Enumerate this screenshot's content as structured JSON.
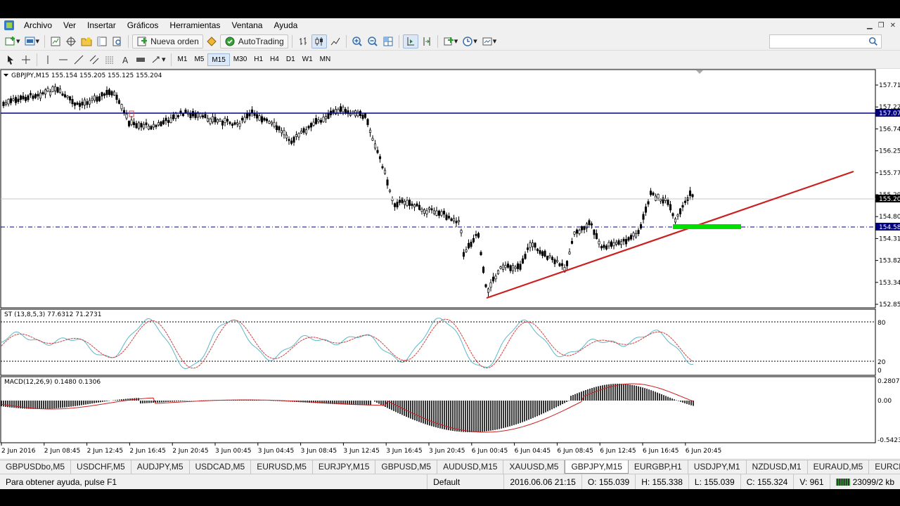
{
  "menubar": {
    "items": [
      "Archivo",
      "Ver",
      "Insertar",
      "Gráficos",
      "Herramientas",
      "Ventana",
      "Ayuda"
    ]
  },
  "toolbar": {
    "new_order_label": "Nueva orden",
    "autotrading_label": "AutoTrading",
    "timeframes": [
      "M1",
      "M5",
      "M15",
      "M30",
      "H1",
      "H4",
      "D1",
      "W1",
      "MN"
    ],
    "active_timeframe": "M15"
  },
  "chart": {
    "header": "GBPJPY,M15  155.154 155.205 155.125 155.204",
    "price_labels": [
      "157.710",
      "157.220",
      "156.740",
      "156.250",
      "155.770",
      "155.290",
      "154.800",
      "154.310",
      "153.820",
      "153.340",
      "152.850"
    ],
    "hline_blue_label": "157.077",
    "hline_dash_label": "154.580",
    "current_price_label": "155.204",
    "time_labels": [
      "2 Jun 2016",
      "2 Jun 08:45",
      "2 Jun 12:45",
      "2 Jun 16:45",
      "2 Jun 20:45",
      "3 Jun 00:45",
      "3 Jun 04:45",
      "3 Jun 08:45",
      "3 Jun 12:45",
      "3 Jun 16:45",
      "3 Jun 20:45",
      "6 Jun 00:45",
      "6 Jun 04:45",
      "6 Jun 08:45",
      "6 Jun 12:45",
      "6 Jun 16:45",
      "6 Jun 20:45"
    ],
    "colors": {
      "candle": "#000000",
      "hline_blue": "#000080",
      "trendline": "#cc2020",
      "marker_green": "#00e000",
      "stoch_main": "#5bb8c8",
      "stoch_signal": "#d04040",
      "macd_signal": "#cc2020"
    }
  },
  "stochastic": {
    "header": "ST (13,8,5,3) 77.6312 71.2731",
    "levels": [
      "80",
      "20",
      "0"
    ]
  },
  "macd": {
    "header": "MACD(12,26,9) 0.1480 0.1306",
    "labels": [
      "0.2807",
      "0.00",
      "-0.5423"
    ]
  },
  "tabs": [
    "GBPUSDbo,M5",
    "USDCHF,M5",
    "AUDJPY,M5",
    "USDCAD,M5",
    "EURUSD,M5",
    "EURJPY,M15",
    "GBPUSD,M5",
    "AUDUSD,M15",
    "XAUUSD,M5",
    "GBPJPY,M15",
    "EURGBP,H1",
    "USDJPY,M1",
    "NZDUSD,M1",
    "EURAUD,M5",
    "EURCHF,M30"
  ],
  "active_tab": "GBPJPY,M15",
  "status": {
    "help": "Para obtener ayuda, pulse F1",
    "profile": "Default",
    "datetime": "2016.06.06 21:15",
    "open": "O: 155.039",
    "high": "H: 155.338",
    "low": "L: 155.039",
    "close": "C: 155.324",
    "volume": "V: 961",
    "traffic": "23099/2 kb"
  }
}
